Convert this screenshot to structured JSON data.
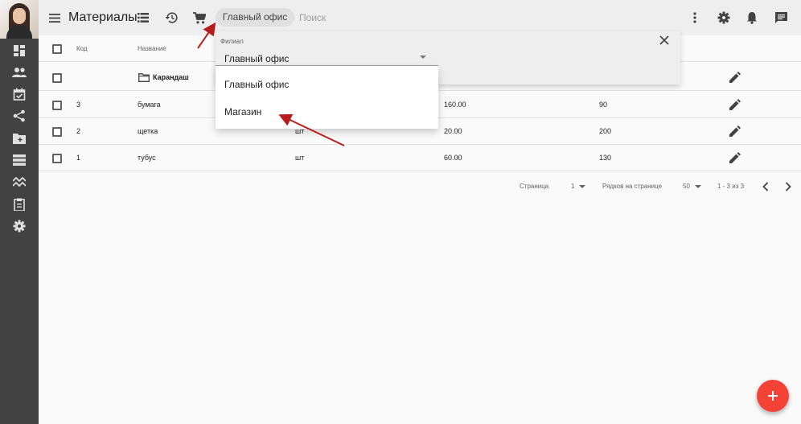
{
  "header": {
    "title": "Материалы",
    "branch_chip": "Главный офис",
    "search_placeholder": "Поиск"
  },
  "table": {
    "columns": {
      "code": "Код",
      "name": "Название"
    },
    "rows": [
      {
        "code": "",
        "name": "Карандаш",
        "unit": "",
        "price": "",
        "qty": "",
        "is_folder": true
      },
      {
        "code": "3",
        "name": "бумага",
        "unit": "",
        "price": "160.00",
        "qty": "90"
      },
      {
        "code": "2",
        "name": "щетка",
        "unit": "шт",
        "price": "20.00",
        "qty": "200"
      },
      {
        "code": "1",
        "name": "тубус",
        "unit": "шт",
        "price": "60.00",
        "qty": "130"
      }
    ]
  },
  "pagination": {
    "page_label": "Страница",
    "page_value": "1",
    "rows_label": "Рядков на странице",
    "rows_value": "50",
    "range": "1 - 3 из 3"
  },
  "filter": {
    "label": "Филиал",
    "value": "Главный офис",
    "options": [
      "Главный офис",
      "Магазин"
    ]
  },
  "colors": {
    "sidebar": "#424242",
    "header": "#eeeeee",
    "fab": "#f44336",
    "annotation_arrow": "#b71c1c"
  },
  "icons": {
    "sidebar": [
      "dashboard-icon",
      "people-icon",
      "event-check-icon",
      "share-icon",
      "folder-add-icon",
      "list-icon",
      "trending-icon",
      "clipboard-icon",
      "settings-icon"
    ],
    "header": [
      "menu-icon",
      "list-view-icon",
      "history-icon",
      "cart-icon",
      "more-vert-icon",
      "settings-icon",
      "bell-icon",
      "chat-icon"
    ]
  }
}
